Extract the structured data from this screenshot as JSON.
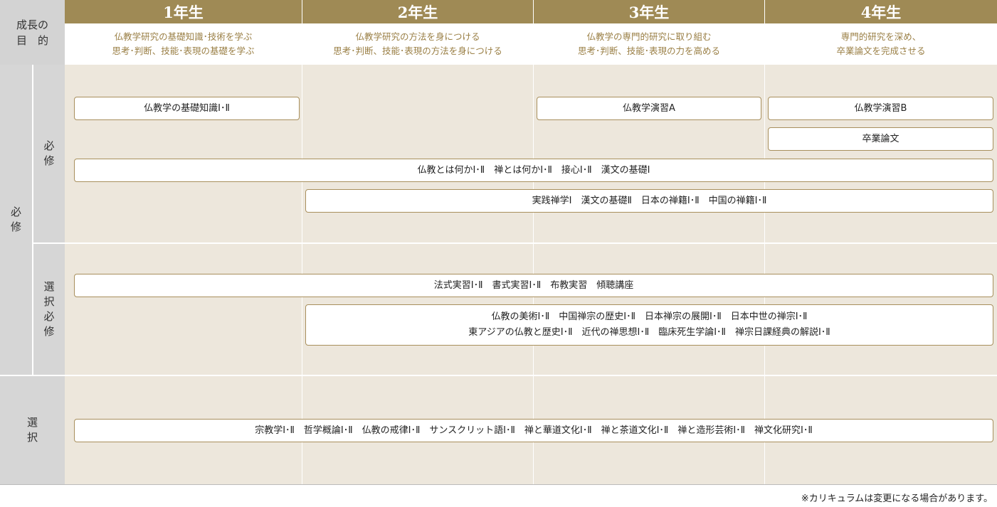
{
  "header": {
    "corner_label": "成長の\n目　的",
    "years": [
      {
        "label": "1年生",
        "goal": "仏教学研究の基礎知識･技術を学ぶ\n思考･判断、技能･表現の基礎を学ぶ"
      },
      {
        "label": "2年生",
        "goal": "仏教学研究の方法を身につける\n思考･判断、技能･表現の方法を身につける"
      },
      {
        "label": "3年生",
        "goal": "仏教学の専門的研究に取り組む\n思考･判断、技能･表現の力を高める"
      },
      {
        "label": "4年生",
        "goal": "専門的研究を深め、\n卒業論文を完成させる"
      }
    ]
  },
  "categories": {
    "required_outer": "必修",
    "required_inner": "必修",
    "elective_required": "選択必修",
    "elective": "選択"
  },
  "courses": {
    "basic_knowledge": "仏教学の基礎知識Ⅰ･Ⅱ",
    "seminar_a": "仏教学演習A",
    "seminar_b": "仏教学演習B",
    "thesis": "卒業論文",
    "required_all": "仏教とは何かⅠ･Ⅱ　禅とは何かⅠ･Ⅱ　接心Ⅰ･Ⅱ　漢文の基礎Ⅰ",
    "required_2to4": "実践禅学Ⅰ　漢文の基礎Ⅱ　日本の禅籍Ⅰ･Ⅱ　中国の禅籍Ⅰ･Ⅱ",
    "elective_required_all": "法式実習Ⅰ･Ⅱ　書式実習Ⅰ･Ⅱ　布教実習　傾聴講座",
    "elective_required_2to4": "仏教の美術Ⅰ･Ⅱ　中国禅宗の歴史Ⅰ･Ⅱ　日本禅宗の展開Ⅰ･Ⅱ　日本中世の禅宗Ⅰ･Ⅱ\n東アジアの仏教と歴史Ⅰ･Ⅱ　近代の禅思想Ⅰ･Ⅱ　臨床死生学論Ⅰ･Ⅱ　禅宗日課経典の解説Ⅰ･Ⅱ",
    "elective_all": "宗教学Ⅰ･Ⅱ　哲学概論Ⅰ･Ⅱ　仏教の戒律Ⅰ･Ⅱ　サンスクリット語Ⅰ･Ⅱ　禅と華道文化Ⅰ･Ⅱ　禅と茶道文化Ⅰ･Ⅱ　禅と造形芸術Ⅰ･Ⅱ　禅文化研究Ⅰ･Ⅱ"
  },
  "note": "※カリキュラムは変更になる場合があります。",
  "colors": {
    "header_gold": "#9f8a55",
    "goal_text": "#9a7f45",
    "body_beige": "#ede7dc",
    "box_border": "#a88f5c",
    "category_gray": "#d6d6d6"
  }
}
